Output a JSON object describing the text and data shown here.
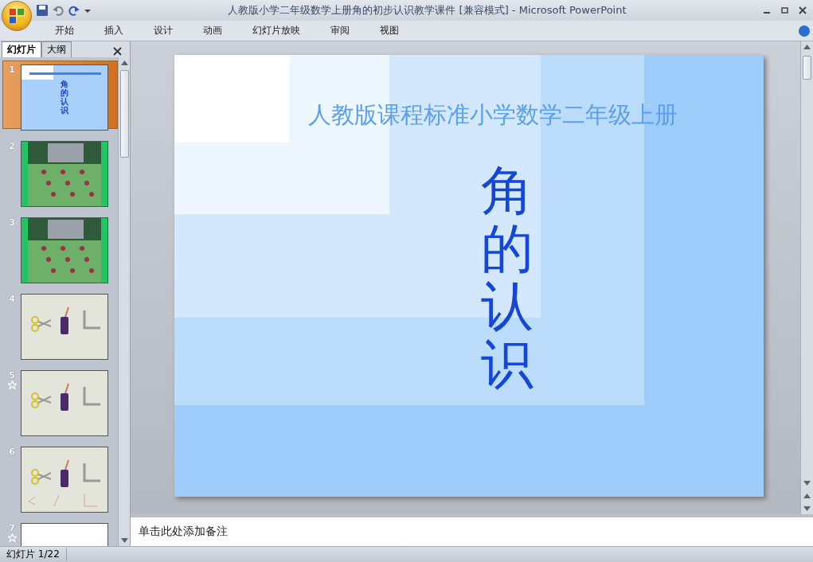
{
  "window": {
    "title": "人教版小学二年级数学上册角的初步认识教学课件 [兼容模式] - Microsoft PowerPoint"
  },
  "ribbon_tabs": [
    {
      "label": "开始",
      "selected": false
    },
    {
      "label": "插入",
      "selected": false
    },
    {
      "label": "设计",
      "selected": false
    },
    {
      "label": "动画",
      "selected": false
    },
    {
      "label": "幻灯片放映",
      "selected": false
    },
    {
      "label": "审阅",
      "selected": false
    },
    {
      "label": "视图",
      "selected": false
    }
  ],
  "panel_tabs": [
    {
      "label": "幻灯片",
      "selected": true
    },
    {
      "label": "大纲",
      "selected": false
    }
  ],
  "thumbnails": [
    {
      "number": "1",
      "kind": "title",
      "selected": true,
      "animated": false,
      "text": "角的认识"
    },
    {
      "number": "2",
      "kind": "playground",
      "selected": false,
      "animated": false
    },
    {
      "number": "3",
      "kind": "playground",
      "selected": false,
      "animated": false
    },
    {
      "number": "4",
      "kind": "objects",
      "selected": false,
      "animated": false
    },
    {
      "number": "5",
      "kind": "objects",
      "selected": false,
      "animated": true
    },
    {
      "number": "6",
      "kind": "objects",
      "selected": false,
      "animated": false
    },
    {
      "number": "7",
      "kind": "blank",
      "selected": false,
      "animated": true
    }
  ],
  "slide": {
    "title": "人教版课程标准小学数学二年级上册",
    "heading": "角的认识"
  },
  "notes": {
    "placeholder": "单击此处添加备注"
  },
  "status_bar": {
    "slide_counter": "幻灯片 1/22"
  }
}
